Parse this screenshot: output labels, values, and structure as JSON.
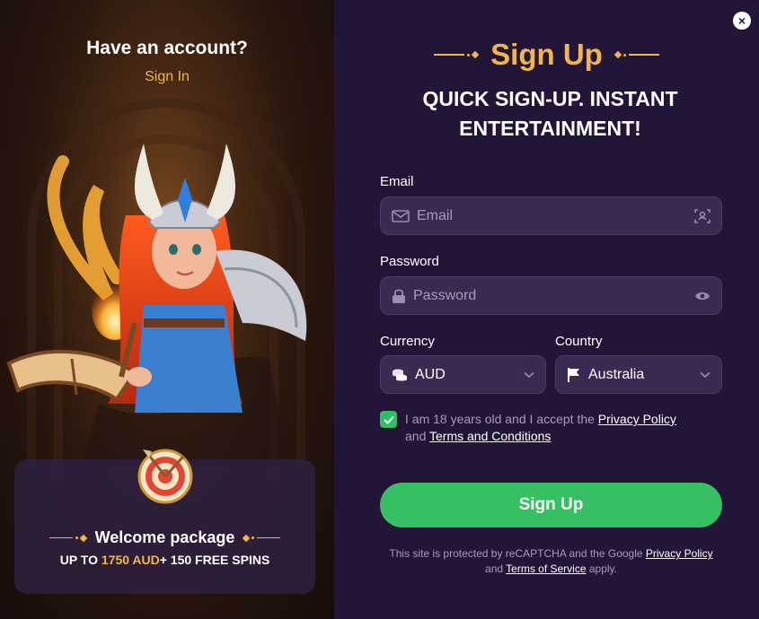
{
  "left": {
    "heading": "Have an account?",
    "sign_in_link": "Sign In",
    "welcome": {
      "title": "Welcome package",
      "offer_prefix": "UP TO ",
      "offer_amount": "1750 AUD",
      "offer_suffix": "+ 150 FREE SPINS"
    }
  },
  "dialog": {
    "close_glyph": "×",
    "title": "Sign Up",
    "tagline": "QUICK SIGN-UP. INSTANT ENTERTAINMENT!"
  },
  "form": {
    "email": {
      "label": "Email",
      "placeholder": "Email"
    },
    "password": {
      "label": "Password",
      "placeholder": "Password"
    },
    "currency": {
      "label": "Currency",
      "value": "AUD"
    },
    "country": {
      "label": "Country",
      "value": "Australia"
    },
    "consent": {
      "checked": true,
      "text_before": "I am 18 years old and I accept the ",
      "privacy_link": "Privacy Policy",
      "text_middle": " and ",
      "terms_link": "Terms and Conditions"
    },
    "submit_label": "Sign Up",
    "recaptcha": {
      "text_before": "This site is protected by reCAPTCHA and the Google ",
      "privacy_link": "Privacy Policy",
      "text_middle": " and ",
      "tos_link": "Terms of Service",
      "text_after": " apply."
    }
  },
  "colors": {
    "accent_gold": "#f0b64a",
    "button_green": "#36c063",
    "panel_bg": "#231538",
    "field_bg": "#3a2950"
  },
  "icons": {
    "email_field": "envelope-icon",
    "email_right": "contact-card-icon",
    "password_field": "lock-icon",
    "password_right": "eye-icon",
    "currency_field": "coins-icon",
    "country_field": "flag-icon"
  }
}
